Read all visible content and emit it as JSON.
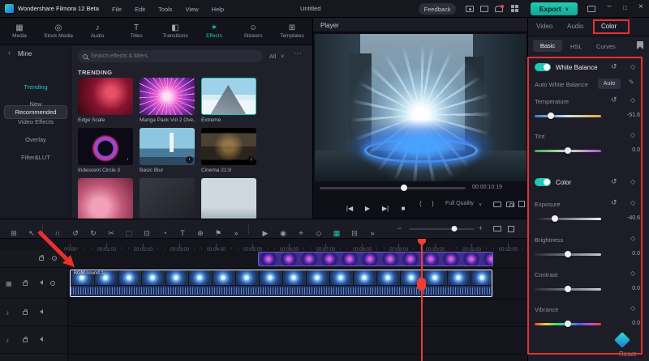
{
  "titlebar": {
    "app_title": "Wondershare Filmora 12 Beta",
    "menus": [
      "File",
      "Edit",
      "Tools",
      "View",
      "Help"
    ],
    "project_title": "Untitled",
    "feedback_label": "Feedback",
    "export_label": "Export"
  },
  "media_tabs": {
    "items": [
      {
        "label": "Media",
        "glyph": "▦"
      },
      {
        "label": "Stock Media",
        "glyph": "◎"
      },
      {
        "label": "Audio",
        "glyph": "♪"
      },
      {
        "label": "Titles",
        "glyph": "T"
      },
      {
        "label": "Transitions",
        "glyph": "◧"
      },
      {
        "label": "Effects",
        "glyph": "✶"
      },
      {
        "label": "Stickers",
        "glyph": "☺"
      },
      {
        "label": "Templates",
        "glyph": "⊞"
      }
    ],
    "active": "Effects"
  },
  "sidebar": {
    "back_label": "Mine",
    "items": [
      "Recommended",
      "Trending",
      "New",
      "Video Effects",
      "Overlay",
      "Filter&LUT"
    ]
  },
  "effects": {
    "search_placeholder": "Search effects & filters",
    "filter_all": "All",
    "section_title": "TRENDING",
    "thumbs": [
      {
        "name": "Edge Scale"
      },
      {
        "name": "Manga Pack Vol 2 Ove.."
      },
      {
        "name": "Extreme"
      },
      {
        "name": "Iridescent Circle 3"
      },
      {
        "name": "Basic Blur"
      },
      {
        "name": "Cinema 21:9"
      }
    ]
  },
  "player": {
    "title": "Player",
    "timecode": "00:00:10:19",
    "quality_label": "Full Quality",
    "progress_pct": 58,
    "mark_in": "{",
    "mark_out": "}",
    "transport": [
      {
        "icon": "prev-frame-icon",
        "glyph": "|◀"
      },
      {
        "icon": "play-icon",
        "glyph": "▶"
      },
      {
        "icon": "next-frame-icon",
        "glyph": "▶|"
      },
      {
        "icon": "stop-icon",
        "glyph": "■"
      }
    ]
  },
  "color_panel": {
    "tabs": [
      "Video",
      "Audio",
      "Color"
    ],
    "active_tab": "Color",
    "subtabs": [
      "Basic",
      "HSL",
      "Curves"
    ],
    "active_subtab": "Basic",
    "white_balance_label": "White Balance",
    "auto_wb_label": "Auto White Balance",
    "auto_button": "Auto",
    "color_label": "Color",
    "sliders": [
      {
        "label": "Temperature",
        "value": "-51.6",
        "pos": 24
      },
      {
        "label": "Tint",
        "value": "0.0",
        "pos": 50
      },
      {
        "label": "Exposure",
        "value": "-40.6",
        "pos": 30
      },
      {
        "label": "Brightness",
        "value": "0.0",
        "pos": 50
      },
      {
        "label": "Contrast",
        "value": "0.0",
        "pos": 50
      },
      {
        "label": "Vibrance",
        "value": "0.0",
        "pos": 50
      }
    ],
    "reset_label": "Reset"
  },
  "timeline": {
    "ruler": [
      "00:00",
      "00:01:00",
      "00:02:00",
      "00:03:00",
      "00:04:00",
      "00:05:00",
      "00:06:00",
      "00:07:00",
      "00:08:00",
      "00:09:00",
      "00:10:00",
      "00:11:00",
      "00:12:00"
    ],
    "clip_name": "BGM sound 1",
    "zoom_pct": 70,
    "toolbar_view": [
      {
        "icon": "media-view-icon",
        "glyph": "⊞"
      },
      {
        "icon": "pointer-icon",
        "glyph": "↖"
      }
    ],
    "toolbar_tools": [
      {
        "icon": "magnet-icon",
        "glyph": "∩"
      },
      {
        "icon": "undo-icon",
        "glyph": "↺"
      },
      {
        "icon": "redo-icon",
        "glyph": "↻"
      },
      {
        "icon": "split-icon",
        "glyph": "✂"
      },
      {
        "icon": "delete-icon",
        "glyph": "⬚"
      },
      {
        "icon": "crop-icon",
        "glyph": "⊡"
      },
      {
        "icon": "speed-icon",
        "glyph": "◔"
      },
      {
        "icon": "text-tool-icon",
        "glyph": "T"
      },
      {
        "icon": "zoom-tool-icon",
        "glyph": "⊕"
      },
      {
        "icon": "marker-icon",
        "glyph": "⚑"
      },
      {
        "icon": "more-tools-icon",
        "glyph": "»"
      }
    ],
    "toolbar_mid": [
      {
        "icon": "play-timeline-icon",
        "glyph": "▶"
      },
      {
        "icon": "record-icon",
        "glyph": "◉"
      },
      {
        "icon": "voiceover-icon",
        "glyph": "⌖"
      },
      {
        "icon": "keyframe-icon",
        "glyph": "◇"
      },
      {
        "icon": "chroma-key-icon",
        "glyph": "▦",
        "accent": true
      },
      {
        "icon": "split-screen-icon",
        "glyph": "⊟"
      },
      {
        "icon": "more-icon",
        "glyph": "»"
      }
    ]
  }
}
